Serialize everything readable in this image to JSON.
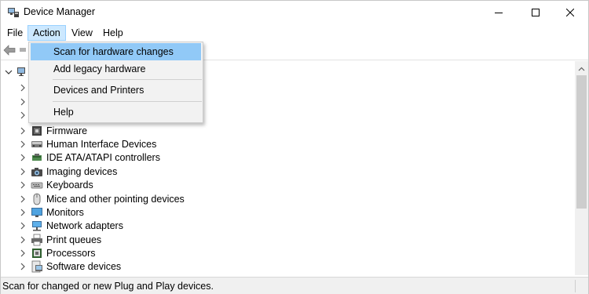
{
  "window": {
    "title": "Device Manager",
    "controls": [
      "minimize",
      "maximize",
      "close"
    ]
  },
  "menubar": {
    "items": [
      {
        "label": "File"
      },
      {
        "label": "Action"
      },
      {
        "label": "View"
      },
      {
        "label": "Help"
      }
    ],
    "active": "Action"
  },
  "action_menu": {
    "items": [
      {
        "label": "Scan for hardware changes",
        "highlighted": true
      },
      {
        "label": "Add legacy hardware"
      },
      {
        "label": "Devices and Printers"
      },
      {
        "label": "Help"
      }
    ]
  },
  "tree": {
    "root_icon": "computer-icon",
    "categories": [
      {
        "label": "Firmware",
        "icon": "firmware-icon"
      },
      {
        "label": "Human Interface Devices",
        "icon": "hid-icon"
      },
      {
        "label": "IDE ATA/ATAPI controllers",
        "icon": "ide-controller-icon"
      },
      {
        "label": "Imaging devices",
        "icon": "camera-icon"
      },
      {
        "label": "Keyboards",
        "icon": "keyboard-icon"
      },
      {
        "label": "Mice and other pointing devices",
        "icon": "mouse-icon"
      },
      {
        "label": "Monitors",
        "icon": "monitor-icon"
      },
      {
        "label": "Network adapters",
        "icon": "network-adapter-icon"
      },
      {
        "label": "Print queues",
        "icon": "printer-icon"
      },
      {
        "label": "Processors",
        "icon": "processor-icon"
      },
      {
        "label": "Software devices",
        "icon": "software-device-icon"
      }
    ]
  },
  "statusbar": {
    "text": "Scan for changed or new Plug and Play devices."
  },
  "colors": {
    "menu_active_bg": "#cce8ff",
    "menu_highlight_bg": "#91c9f7",
    "dropdown_bg": "#f2f2f2"
  }
}
